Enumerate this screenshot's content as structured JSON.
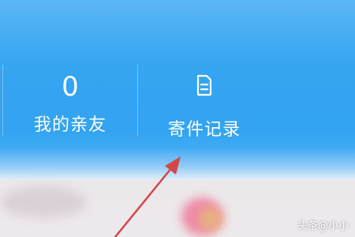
{
  "stats": [
    {
      "value": "0",
      "label": "我的亲友"
    },
    {
      "label": "寄件记录",
      "icon": "document-icon"
    }
  ],
  "watermark": "头条@小小",
  "colors": {
    "header_blue": "#38a6f2",
    "text_white": "#ffffff",
    "annotation_arrow": "#d04848"
  }
}
